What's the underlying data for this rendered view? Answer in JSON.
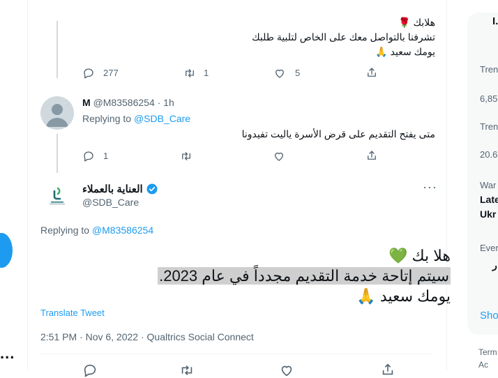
{
  "tweet1": {
    "lines": [
      "هلابك 🌹",
      "تشرفنا بالتواصل معك على الخاص لتلبية طلبك",
      "يومك سعيد 🙏"
    ],
    "reply_count": "277",
    "retweet_count": "1",
    "like_count": "5"
  },
  "tweet2": {
    "display_name": "M",
    "handle": "@M83586254",
    "time": "· 1h",
    "replying_prefix": "Replying to",
    "replying_handle": "@SDB_Care",
    "text": "متى يفتح التقديم على قرض الأسرة ياليت تفيدونا",
    "reply_count": "1"
  },
  "main": {
    "display_name": "العناية بالعملاء",
    "handle": "@SDB_Care",
    "replying_prefix": "Replying to",
    "replying_handle": "@M83586254",
    "line1": "هلا بك 💚",
    "line2": "سيتم إتاحة خدمة التقديم مجدداً في عام 2023.",
    "line3": "يومك سعيد 🙏",
    "translate": "Translate Tweet",
    "meta": "2:51 PM · Nov 6, 2022 · Qualtrics Social Connect"
  },
  "sidebar": {
    "top": "I.",
    "items": [
      {
        "label": "Tren",
        "value": "6,85"
      },
      {
        "label": "Tren",
        "value": "20.6"
      },
      {
        "label": "War",
        "value": "Late",
        "value2": "Ukr"
      },
      {
        "label": "Even",
        "value": "ر"
      }
    ],
    "show": "Sho",
    "terms": "Term",
    "ac": "Ac"
  },
  "left": {
    "more": "..."
  }
}
